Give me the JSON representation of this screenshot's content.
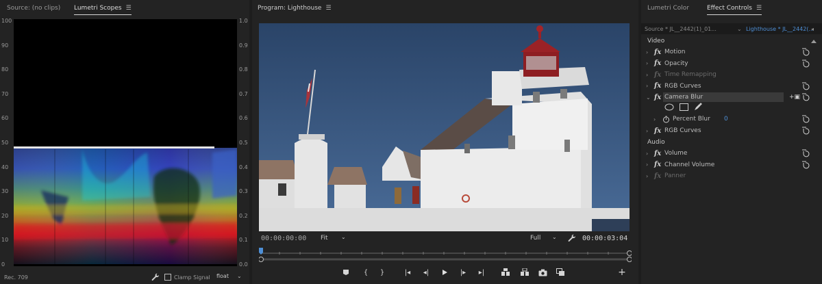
{
  "scopes_panel": {
    "tab_source": "Source: (no clips)",
    "tab_scopes": "Lumetri Scopes",
    "y_labels_left": [
      "100",
      "90",
      "80",
      "70",
      "60",
      "50",
      "40",
      "30",
      "20",
      "10",
      "0"
    ],
    "y_labels_right": [
      "1.0",
      "0.9",
      "0.8",
      "0.7",
      "0.6",
      "0.5",
      "0.4",
      "0.3",
      "0.2",
      "0.1",
      "0.0"
    ],
    "color_space": "Rec. 709",
    "clamp_label": "Clamp Signal",
    "precision_value": "float"
  },
  "program_panel": {
    "title": "Program: Lighthouse",
    "current_time": "00:00:00:00",
    "zoom_value": "Fit",
    "resolution_value": "Full",
    "duration": "00:00:03:04",
    "accent": "#4e8fd6"
  },
  "effect_panel": {
    "tab_lumetri": "Lumetri Color",
    "tab_effect": "Effect Controls",
    "source_label": "Source * JL__2442(1)_01...",
    "sequence_label": "Lighthouse * JL__2442(...",
    "video_header": "Video",
    "audio_header": "Audio",
    "effects": [
      {
        "name": "Motion",
        "enabled": true
      },
      {
        "name": "Opacity",
        "enabled": true
      },
      {
        "name": "Time Remapping",
        "enabled": false
      },
      {
        "name": "RGB Curves",
        "enabled": true
      },
      {
        "name": "Camera Blur",
        "enabled": true,
        "expanded": true
      }
    ],
    "percent_blur_label": "Percent Blur",
    "percent_blur_value": "0",
    "effects_after": [
      {
        "name": "RGB Curves",
        "enabled": true
      }
    ],
    "audio_effects": [
      {
        "name": "Volume",
        "enabled": true
      },
      {
        "name": "Channel Volume",
        "enabled": true
      },
      {
        "name": "Panner",
        "enabled": false
      }
    ]
  },
  "icons": [
    "wrench-icon",
    "play-icon",
    "camera-icon",
    "add-icon",
    "reset-icon",
    "ellipse-mask-icon",
    "rectangle-mask-icon",
    "pen-mask-icon",
    "stopwatch-icon"
  ]
}
